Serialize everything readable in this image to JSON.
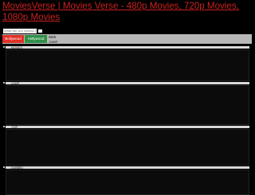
{
  "header": {
    "title": "MoviesVerse | Movies Verse - 480p Movies, 720p Movies, 1080p Movies"
  },
  "search": {
    "placeholder": "What are you looking for ?"
  },
  "nav": {
    "tabs": [
      {
        "label": "Bollywood"
      },
      {
        "label": "Hollywood"
      },
      {
        "label": "Web"
      }
    ],
    "sub_link": "1080P"
  },
  "sections": [
    {
      "label": "MOVIES"
    },
    {
      "label": "2160P"
    },
    {
      "label": "720P"
    },
    {
      "label": "DUBBED"
    }
  ],
  "colors": {
    "title": "#cc2020",
    "bollywood_tab": "#e03025",
    "hollywood_tab": "#2f8f46",
    "nav_bar": "#b8b8b8",
    "section_bar": "#d8d8d8",
    "background": "#000000"
  }
}
